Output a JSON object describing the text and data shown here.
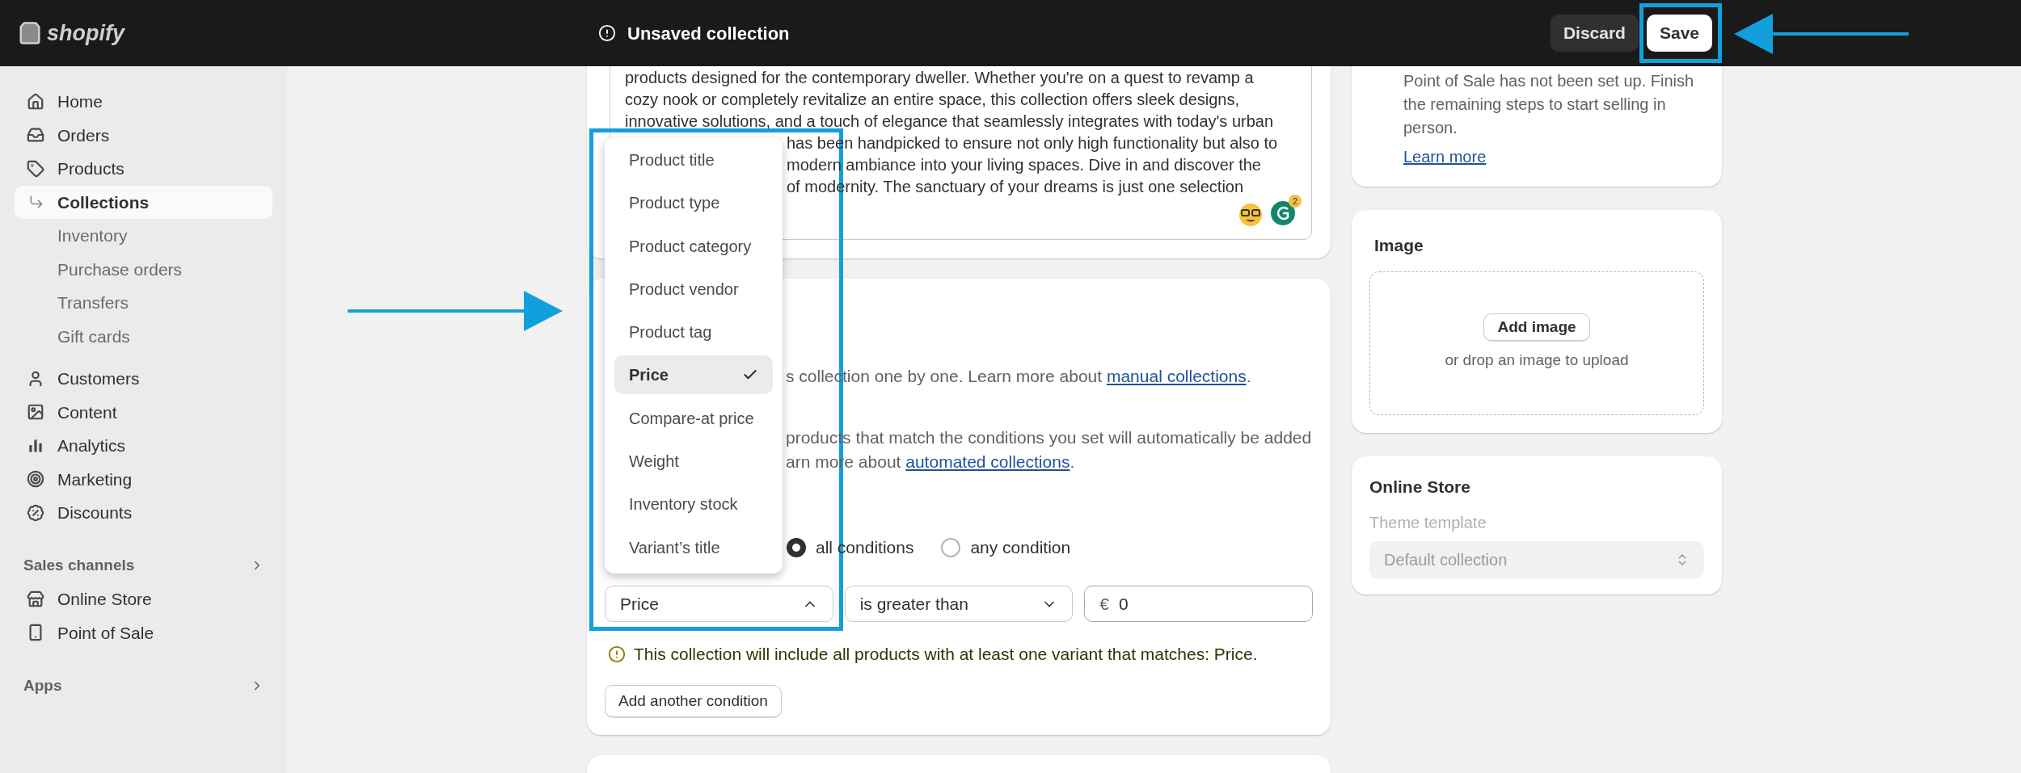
{
  "top_bar": {
    "logo": "shopify",
    "title": "Unsaved collection",
    "buttons": [
      {
        "label": "Discard",
        "kind": "secondary"
      },
      {
        "label": "Save",
        "kind": "primary"
      }
    ]
  },
  "sidebar": {
    "main": [
      {
        "label": "Home",
        "selected": false
      },
      {
        "label": "Orders",
        "selected": false
      },
      {
        "label": "Products",
        "selected": false,
        "children": [
          {
            "label": "Collections",
            "selected": true
          },
          {
            "label": "Inventory",
            "selected": false
          },
          {
            "label": "Purchase orders",
            "selected": false
          },
          {
            "label": "Transfers",
            "selected": false
          },
          {
            "label": "Gift cards",
            "selected": false
          }
        ]
      },
      {
        "label": "Customers",
        "selected": false
      },
      {
        "label": "Content",
        "selected": false
      },
      {
        "label": "Analytics",
        "selected": false
      },
      {
        "label": "Marketing",
        "selected": false
      },
      {
        "label": "Discounts",
        "selected": false
      }
    ],
    "sales_channels": {
      "title": "Sales channels",
      "items": [
        {
          "label": "Online Store",
          "selected": false
        },
        {
          "label": "Point of Sale",
          "selected": false
        }
      ]
    },
    "apps": {
      "title": "Apps"
    }
  },
  "description": {
    "lines": [
      "products designed for the contemporary dweller. Whether you're on a quest to revamp a",
      "cozy nook or completely revitalize an entire space, this collection offers sleek designs,",
      "innovative solutions, and a touch of elegance that seamlessly integrates with today's urban"
    ],
    "lines_beside_menu": [
      "has been handpicked to ensure not only high functionality but also to",
      "modern ambiance into your living spaces. Dive in and discover the",
      "of modernity. The sanctuary of your dreams is just one selection"
    ],
    "grammar_badge": "2"
  },
  "conditions_card": {
    "manual_note": {
      "text": "s collection one by one. Learn more about ",
      "link": "manual collections",
      "end": "."
    },
    "automated_note": {
      "first_line": "products that match the conditions you set will automatically be added",
      "text": "arn more about ",
      "link": "automated collections",
      "end": "."
    },
    "match_options": [
      {
        "label": "all conditions",
        "selected": true
      },
      {
        "label": "any condition",
        "selected": false
      }
    ],
    "condition": {
      "field": {
        "value": "Price",
        "expanded": true
      },
      "operator": {
        "value": "is greater than",
        "expanded": false
      },
      "amount": {
        "prefix": "€",
        "value": "0"
      }
    },
    "warning": "This collection will include all products with at least one variant that matches: Price.",
    "add_button": "Add another condition"
  },
  "field_menu": {
    "options": [
      {
        "label": "Product title",
        "selected": false
      },
      {
        "label": "Product type",
        "selected": false
      },
      {
        "label": "Product category",
        "selected": false
      },
      {
        "label": "Product vendor",
        "selected": false
      },
      {
        "label": "Product tag",
        "selected": false
      },
      {
        "label": "Price",
        "selected": true
      },
      {
        "label": "Compare-at price",
        "selected": false
      },
      {
        "label": "Weight",
        "selected": false
      },
      {
        "label": "Inventory stock",
        "selected": false
      },
      {
        "label": "Variant’s title",
        "selected": false
      }
    ]
  },
  "pos_card": {
    "text": "Point of Sale has not been set up. Finish the remaining steps to start selling in person.",
    "link": "Learn more"
  },
  "image_card": {
    "title": "Image",
    "button": "Add image",
    "hint": "or drop an image to upload"
  },
  "online_store_card": {
    "title": "Online Store",
    "label": "Theme template",
    "select": {
      "value": "Default collection",
      "disabled": true
    }
  }
}
